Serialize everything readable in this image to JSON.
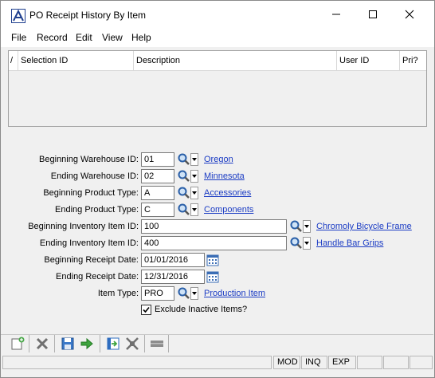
{
  "window": {
    "title": "PO Receipt History By Item"
  },
  "menu": [
    "File",
    "Record",
    "Edit",
    "View",
    "Help"
  ],
  "grid": {
    "headers": [
      "Selection ID",
      "Description",
      "User ID",
      "Pri?"
    ]
  },
  "form": {
    "beg_wh_label": "Beginning Warehouse ID:",
    "beg_wh_value": "01",
    "beg_wh_desc": "Oregon",
    "end_wh_label": "Ending Warehouse ID:",
    "end_wh_value": "02",
    "end_wh_desc": "Minnesota",
    "beg_pt_label": "Beginning Product Type:",
    "beg_pt_value": "A",
    "beg_pt_desc": "Accessories",
    "end_pt_label": "Ending Product Type:",
    "end_pt_value": "C",
    "end_pt_desc": "Components",
    "beg_item_label": "Beginning Inventory Item ID:",
    "beg_item_value": "100",
    "beg_item_desc": "Chromoly Bicycle Frame",
    "end_item_label": "Ending Inventory Item ID:",
    "end_item_value": "400",
    "end_item_desc": "Handle Bar Grips",
    "beg_date_label": "Beginning Receipt Date:",
    "beg_date_value": "01/01/2016",
    "end_date_label": "Ending Receipt Date:",
    "end_date_value": "12/31/2016",
    "item_type_label": "Item Type:",
    "item_type_value": "PRO",
    "item_type_desc": "Production Item",
    "exclude_label": "Exclude Inactive Items?",
    "exclude_checked": true
  },
  "status": {
    "mod": "MOD",
    "inq": "INQ",
    "exp": "EXP"
  },
  "colors": {
    "link": "#1b3cc4",
    "accent": "#1f3f8f"
  }
}
